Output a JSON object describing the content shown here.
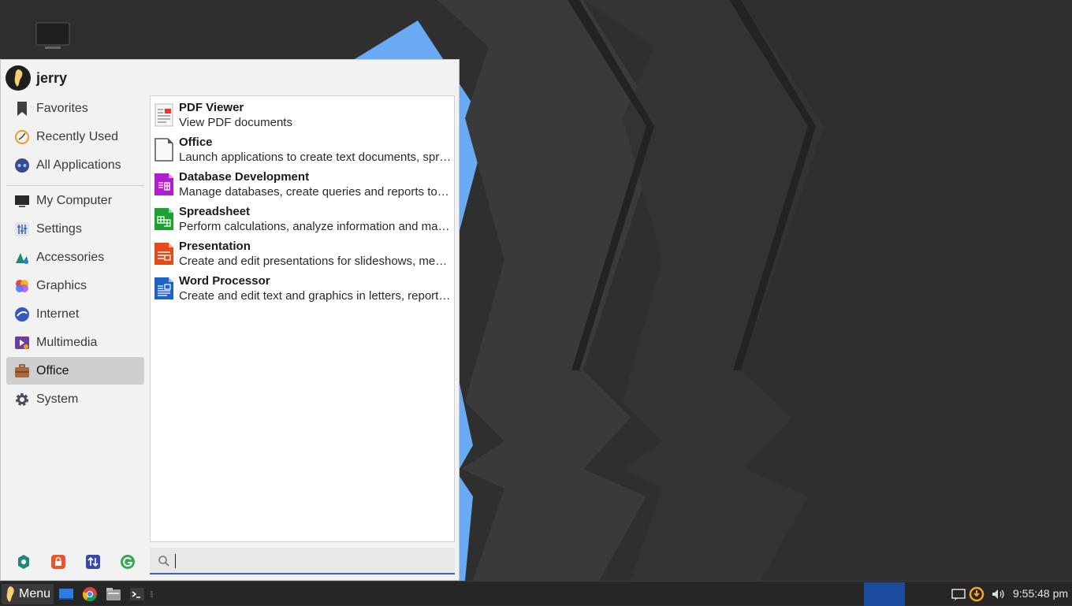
{
  "user": {
    "name": "jerry"
  },
  "sidebar": {
    "items": [
      {
        "label": "Favorites",
        "icon": "bookmark-icon"
      },
      {
        "label": "Recently Used",
        "icon": "clock-icon"
      },
      {
        "label": "All Applications",
        "icon": "apps-icon"
      },
      {
        "label": "My Computer",
        "icon": "monitor-icon"
      },
      {
        "label": "Settings",
        "icon": "settings-sliders-icon"
      },
      {
        "label": "Accessories",
        "icon": "accessories-icon"
      },
      {
        "label": "Graphics",
        "icon": "graphics-icon"
      },
      {
        "label": "Internet",
        "icon": "globe-icon"
      },
      {
        "label": "Multimedia",
        "icon": "multimedia-icon"
      },
      {
        "label": "Office",
        "icon": "briefcase-icon",
        "active": true
      },
      {
        "label": "System",
        "icon": "gear-icon"
      }
    ]
  },
  "apps": [
    {
      "name": "PDF Viewer",
      "desc": "View PDF documents",
      "icon": "pdf-icon"
    },
    {
      "name": "Office",
      "desc": "Launch applications to create text documents, spreadsheets, presentations, drawings, formulas, and databases",
      "icon": "office-doc-icon"
    },
    {
      "name": "Database Development",
      "desc": "Manage databases, create queries and reports to track and manage your information",
      "icon": "database-icon"
    },
    {
      "name": "Spreadsheet",
      "desc": "Perform calculations, analyze information and manage lists in spreadsheets",
      "icon": "spreadsheet-icon"
    },
    {
      "name": "Presentation",
      "desc": "Create and edit presentations for slideshows, meetings and web pages",
      "icon": "presentation-icon"
    },
    {
      "name": "Word Processor",
      "desc": "Create and edit text and graphics in letters, reports, documents and web pages",
      "icon": "word-processor-icon"
    }
  ],
  "bottom_buttons": [
    "software-manager-icon",
    "lock-screen-icon",
    "switch-user-icon",
    "logout-icon"
  ],
  "search": {
    "placeholder": "",
    "value": ""
  },
  "taskbar": {
    "menu_label": "Menu",
    "launchers": [
      "show-desktop-icon",
      "chrome-icon",
      "file-manager-icon",
      "terminal-icon"
    ],
    "tray": [
      "notification-icon",
      "update-icon",
      "volume-icon"
    ],
    "clock": "9:55:48 pm"
  },
  "colors": {
    "accent": "#2a6ac8",
    "workspace": "#1a4b9c",
    "wallpaper_blue": "#6aaaf5"
  }
}
